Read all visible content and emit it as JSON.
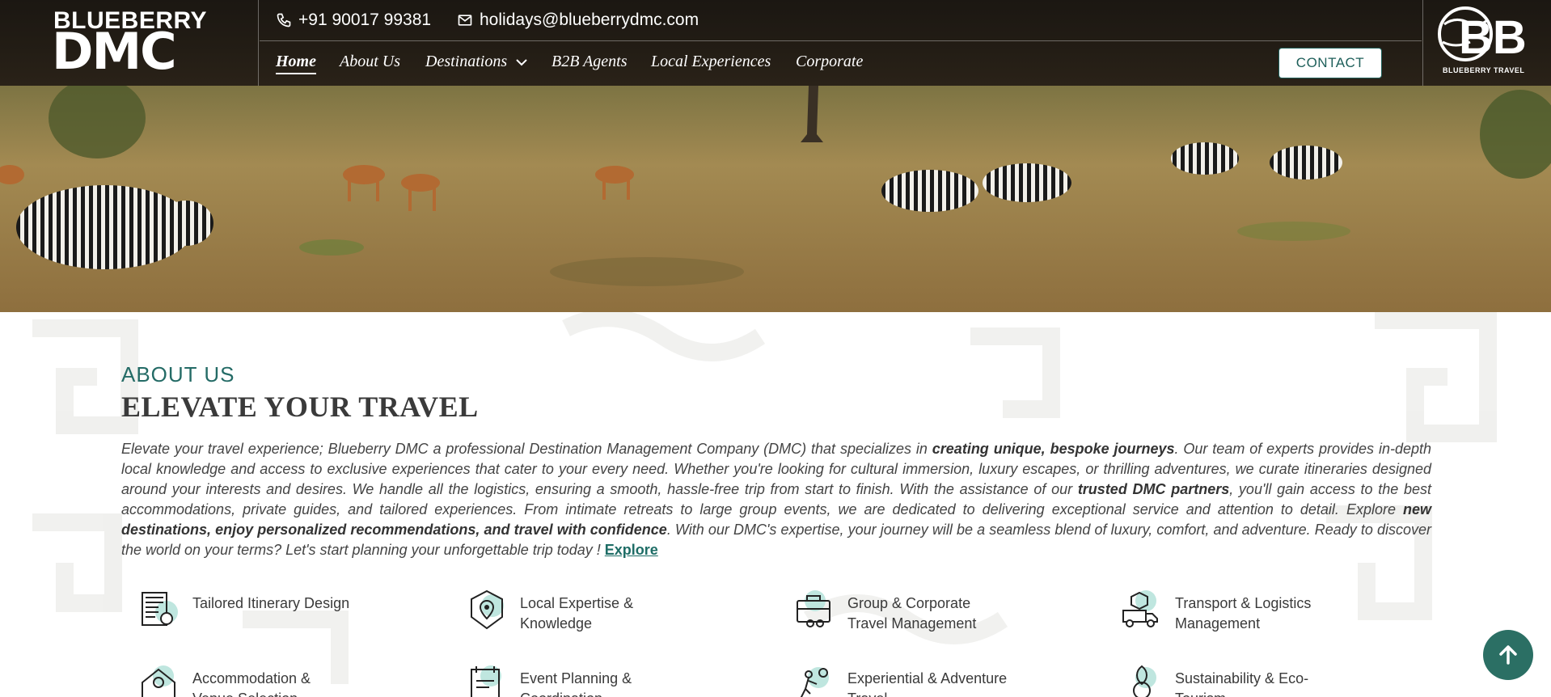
{
  "header": {
    "logo_line1": "BLUEBERRY",
    "logo_line2": "DMC",
    "phone": "+91 90017 99381",
    "email": "holidays@blueberrydmc.com",
    "nav": [
      {
        "label": "Home"
      },
      {
        "label": "About Us"
      },
      {
        "label": "Destinations"
      },
      {
        "label": "B2B Agents"
      },
      {
        "label": "Local Experiences"
      },
      {
        "label": "Corporate"
      }
    ],
    "contact_button": "CONTACT",
    "bb_logo_text": "BB",
    "bb_logo_sub": "BLUEBERRY TRAVEL"
  },
  "about": {
    "eyebrow": "ABOUT US",
    "title": "ELEVATE YOUR TRAVEL",
    "p1": "Elevate your travel experience; Blueberry DMC a professional Destination Management Company (DMC) that specializes in ",
    "b1": "creating unique, bespoke journeys",
    "p2": ". Our team of experts provides in-depth local knowledge and access to exclusive experiences that cater to your every need. Whether you're looking for cultural immersion, luxury escapes, or thrilling adventures, we curate itineraries designed around your interests and desires. We handle all the logistics, ensuring a smooth, hassle-free trip from start to finish. With the assistance of our ",
    "b2": "trusted DMC partners",
    "p3": ", you'll gain access to the best accommodations, private guides, and tailored experiences. From intimate retreats to large group events, we are dedicated to delivering exceptional service and attention to detail. Explore ",
    "b3": "new destinations, enjoy personalized recommendations, and travel with confidence",
    "p4": ". With our DMC's expertise, your journey will be a seamless blend of luxury, comfort, and adventure. Ready to discover the world on your terms? Let's start planning your unforgettable trip today ! ",
    "explore": "Explore"
  },
  "services": [
    {
      "label": "Tailored Itinerary Design",
      "icon": "itinerary-icon"
    },
    {
      "label": "Local Expertise & Knowledge",
      "icon": "location-pin-icon"
    },
    {
      "label": "Group & Corporate Travel Management",
      "icon": "briefcase-icon"
    },
    {
      "label": "Transport & Logistics Management",
      "icon": "truck-icon"
    },
    {
      "label": "Accommodation & Venue Selection",
      "icon": "hotel-icon"
    },
    {
      "label": "Event Planning & Coordination",
      "icon": "event-icon"
    },
    {
      "label": "Experiential & Adventure Travel",
      "icon": "adventure-icon"
    },
    {
      "label": "Sustainability & Eco-Tourism",
      "icon": "eco-icon"
    }
  ],
  "colors": {
    "accent": "#246b66",
    "header_bg": "#1b1712",
    "scroll_btn": "#2b6f64"
  }
}
